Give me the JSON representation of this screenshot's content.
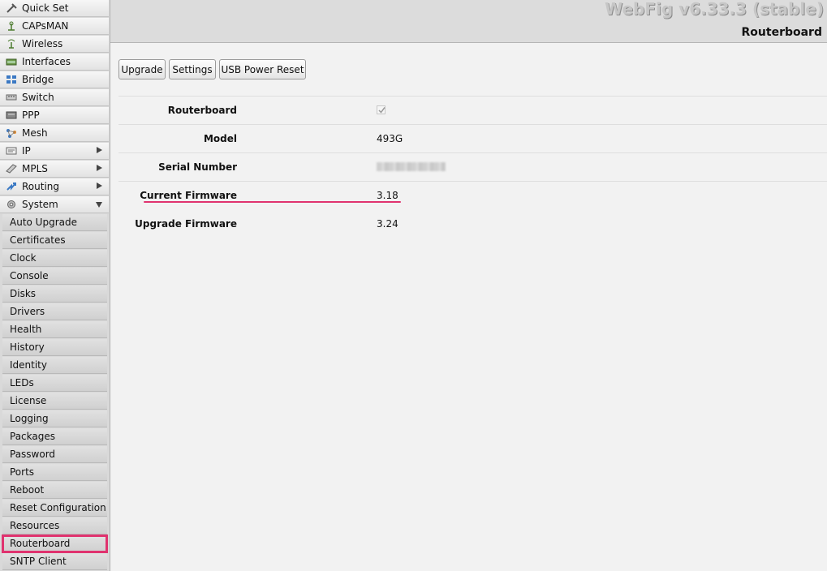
{
  "app_title": "WebFig v6.33.3 (stable)",
  "page_title": "Routerboard",
  "sidebar": {
    "items": [
      {
        "label": "Quick Set",
        "icon": "quick-set-icon"
      },
      {
        "label": "CAPsMAN",
        "icon": "capsman-icon"
      },
      {
        "label": "Wireless",
        "icon": "wireless-icon"
      },
      {
        "label": "Interfaces",
        "icon": "interfaces-icon"
      },
      {
        "label": "Bridge",
        "icon": "bridge-icon"
      },
      {
        "label": "Switch",
        "icon": "switch-icon"
      },
      {
        "label": "PPP",
        "icon": "ppp-icon"
      },
      {
        "label": "Mesh",
        "icon": "mesh-icon"
      },
      {
        "label": "IP",
        "icon": "ip-icon",
        "arrow": "right"
      },
      {
        "label": "MPLS",
        "icon": "mpls-icon",
        "arrow": "right"
      },
      {
        "label": "Routing",
        "icon": "routing-icon",
        "arrow": "right"
      },
      {
        "label": "System",
        "icon": "system-icon",
        "arrow": "down"
      }
    ],
    "system_submenu": [
      "Auto Upgrade",
      "Certificates",
      "Clock",
      "Console",
      "Disks",
      "Drivers",
      "Health",
      "History",
      "Identity",
      "LEDs",
      "License",
      "Logging",
      "Packages",
      "Password",
      "Ports",
      "Reboot",
      "Reset Configuration",
      "Resources",
      "Routerboard",
      "SNTP Client"
    ],
    "selected": "Routerboard"
  },
  "toolbar": {
    "upgrade": "Upgrade",
    "settings": "Settings",
    "usb_power_reset": "USB Power Reset"
  },
  "form": {
    "routerboard_label": "Routerboard",
    "routerboard_checked": true,
    "model_label": "Model",
    "model_value": "493G",
    "serial_label": "Serial Number",
    "current_fw_label": "Current Firmware",
    "current_fw_value": "3.18",
    "upgrade_fw_label": "Upgrade Firmware",
    "upgrade_fw_value": "3.24"
  },
  "colors": {
    "highlight": "#e0336f"
  }
}
